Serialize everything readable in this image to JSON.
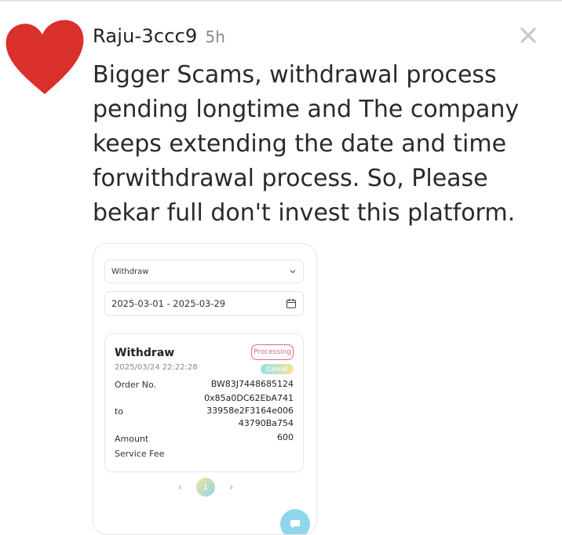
{
  "post": {
    "username": "Raju-3ccc9",
    "time": "5h",
    "text": "Bigger Scams, withdrawal process pending longtime and The company keeps extending the date and time forwithdrawal process. So, Please bekar full don't invest this platform."
  },
  "icons": {
    "avatar": "heart-icon",
    "close": "close-icon",
    "calendar": "calendar-icon",
    "chevron": "chevron-down-icon",
    "chat": "chat-bubble-icon"
  },
  "colors": {
    "heart": "#d9302b",
    "status_border": "#d96a86",
    "accent_cyan": "#8fd6ec",
    "accent_yellow": "#f6e29a"
  },
  "screenshot": {
    "type_select": "Withdraw",
    "date_range": "2025-03-01 - 2025-03-29",
    "card": {
      "title": "Withdraw",
      "datetime": "2025/03/24 22:22:28",
      "status": "Processing",
      "cancel": "Cancel",
      "order_label": "Order No.",
      "order_value": "BW83J7448685124",
      "to_label": "to",
      "to_line1": "0x85a0DC62EbA741",
      "to_line2": "33958e2F3164e006",
      "to_line3": "43790Ba754",
      "amount_label": "Amount",
      "amount_value": "600",
      "fee_label": "Service Fee"
    },
    "pager": {
      "prev": "‹",
      "current": "1",
      "next": "›"
    }
  }
}
